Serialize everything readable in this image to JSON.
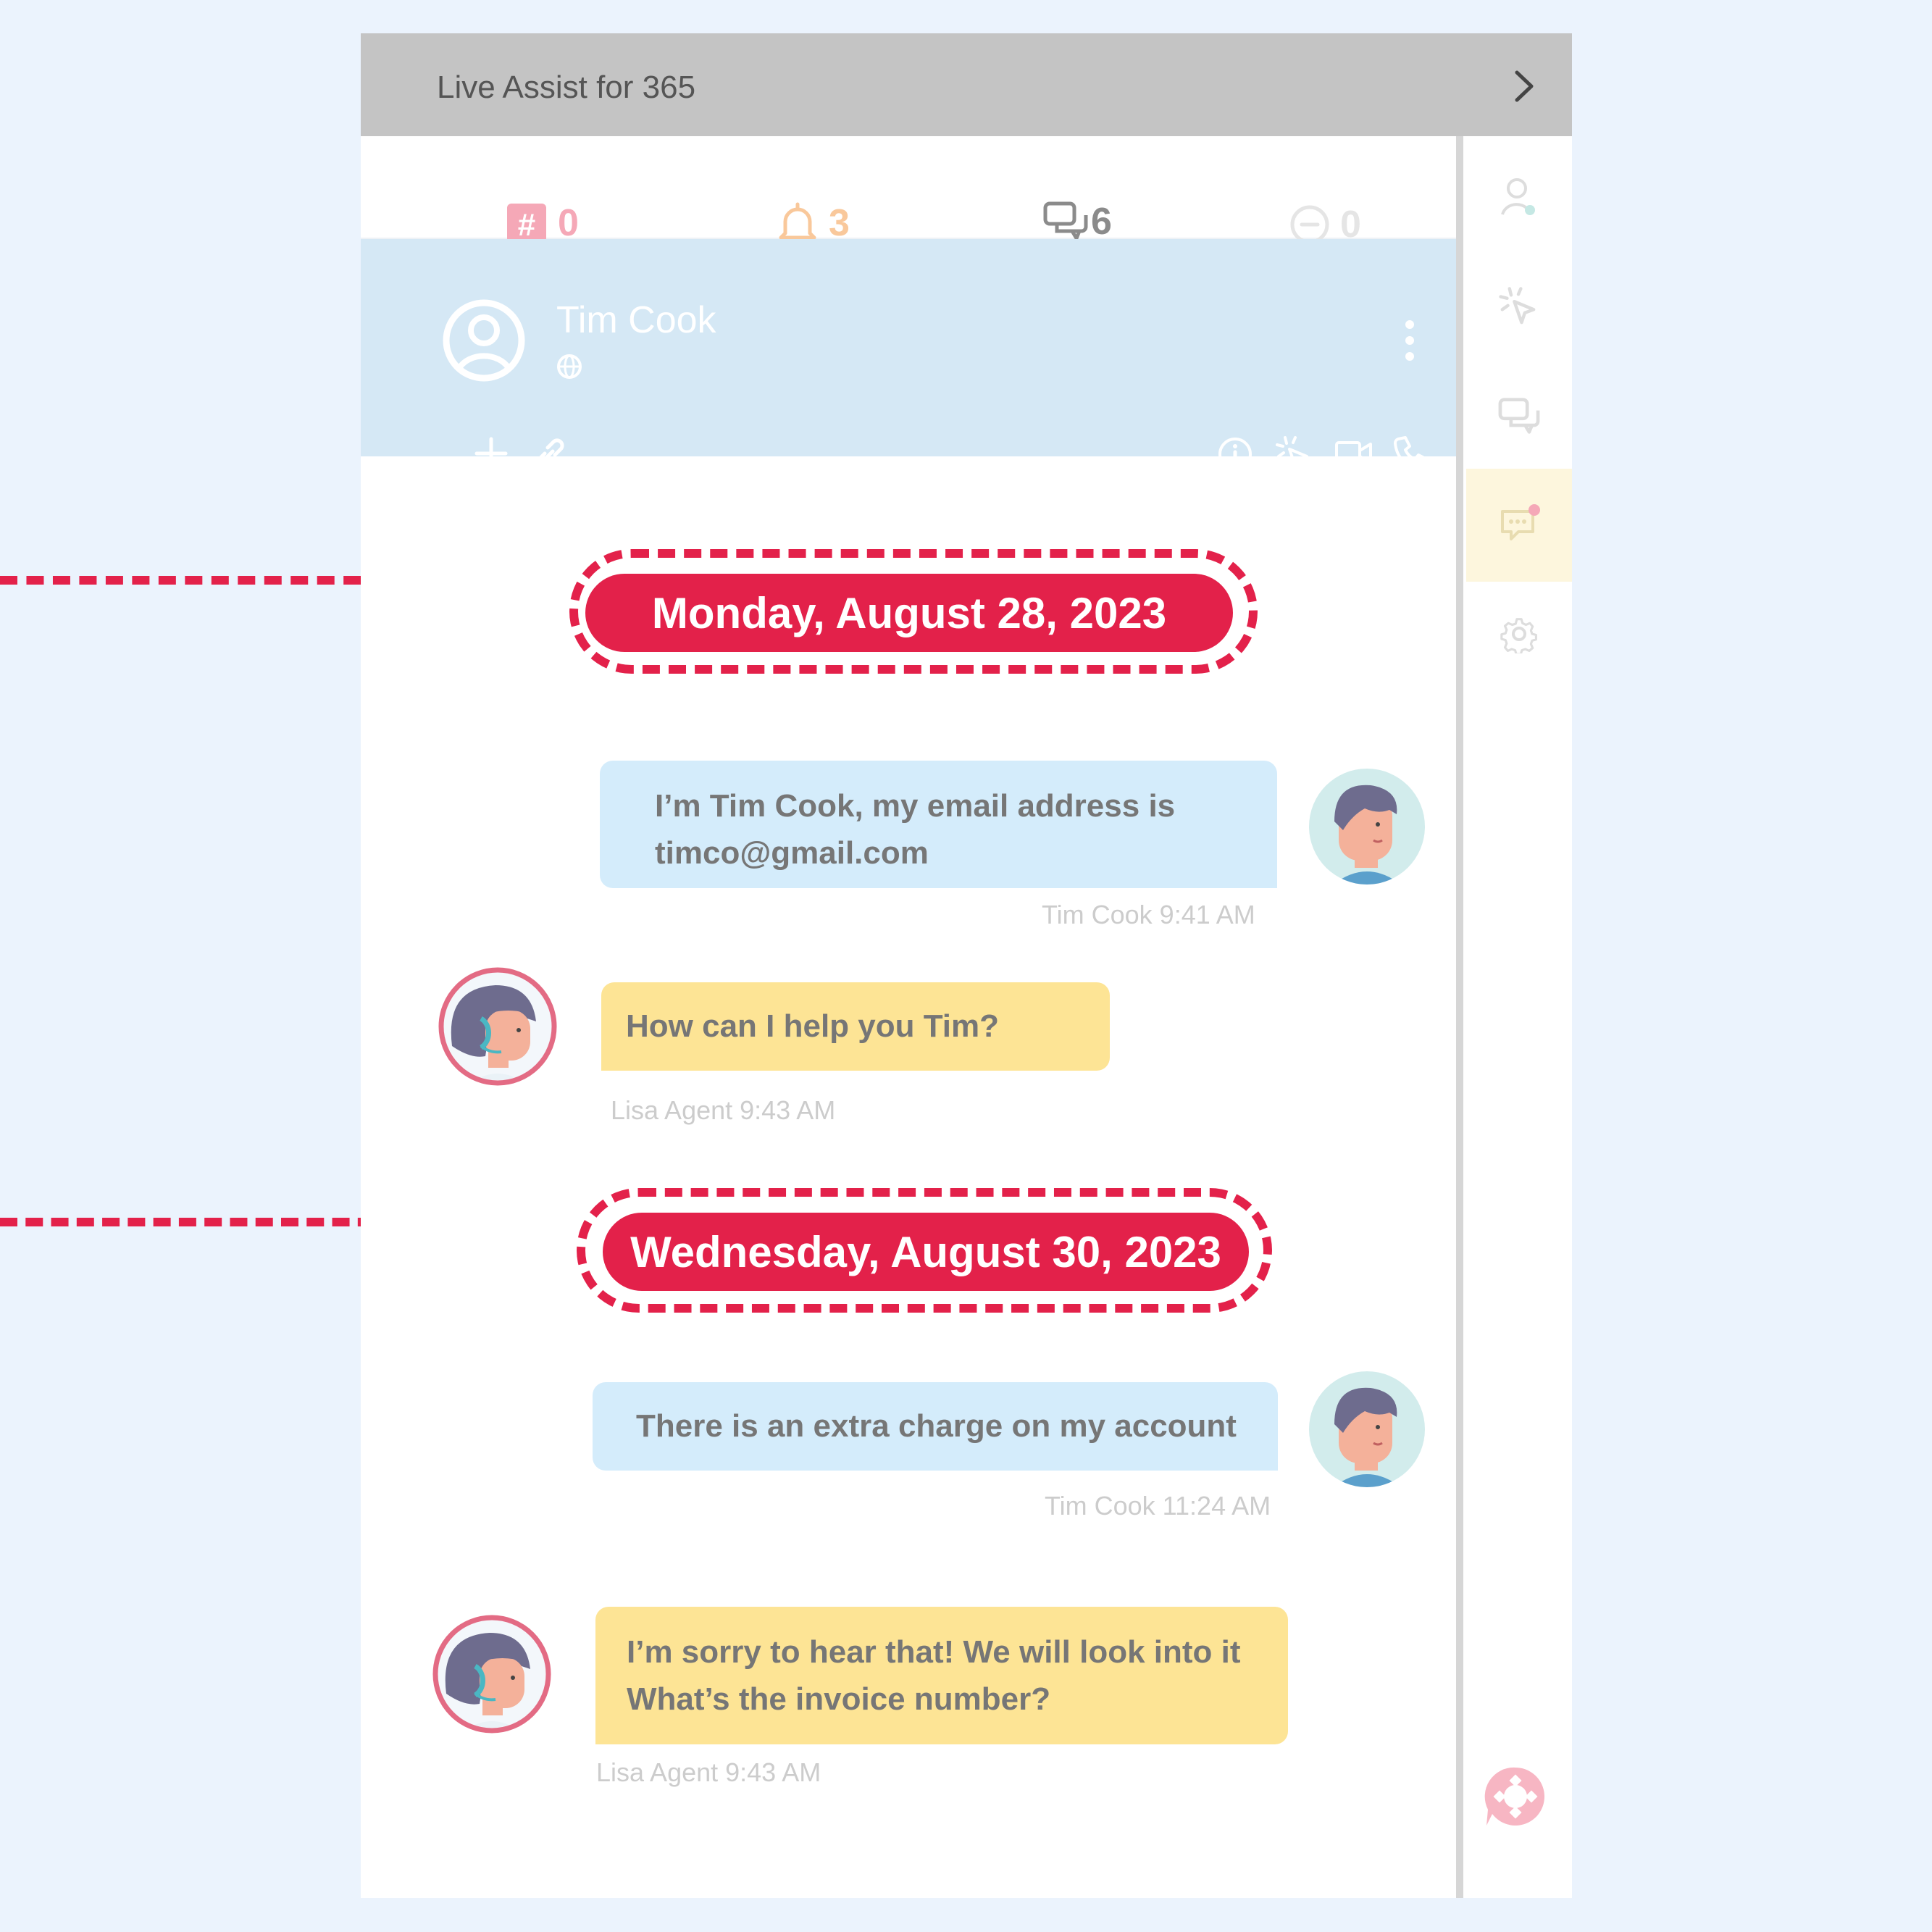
{
  "app": {
    "title": "Live Assist for 365"
  },
  "counters": [
    {
      "name": "hash",
      "value": "0",
      "color": "#f5a8b7"
    },
    {
      "name": "bell",
      "value": "3",
      "color": "#f9c89b"
    },
    {
      "name": "chats",
      "value": "6",
      "color": "#8b8b8b"
    },
    {
      "name": "minus",
      "value": "0",
      "color": "#e5e5e5"
    }
  ],
  "contact": {
    "name": "Tim Cook"
  },
  "dates": {
    "first": "Monday, August 28, 2023",
    "second": "Wednesday, August 30, 2023"
  },
  "messages": [
    {
      "from": "customer",
      "lines": [
        "I’m Tim Cook, my email address is",
        "timco@gmail.com"
      ],
      "meta": "Tim Cook 9:41 AM"
    },
    {
      "from": "agent",
      "lines": [
        "How can I help you Tim?"
      ],
      "meta": "Lisa Agent 9:43 AM"
    },
    {
      "from": "customer",
      "lines": [
        "There is an extra charge on my account"
      ],
      "meta": "Tim Cook 11:24 AM"
    },
    {
      "from": "agent",
      "lines": [
        "I’m sorry to hear that! We will look into it",
        "What’s the invoice number?"
      ],
      "meta": "Lisa Agent 9:43 AM"
    }
  ],
  "colors": {
    "accent": "#e3214a",
    "customer_bubble": "#d4ecfb",
    "agent_bubble": "#fde495",
    "contact_header": "#d5e8f5"
  }
}
